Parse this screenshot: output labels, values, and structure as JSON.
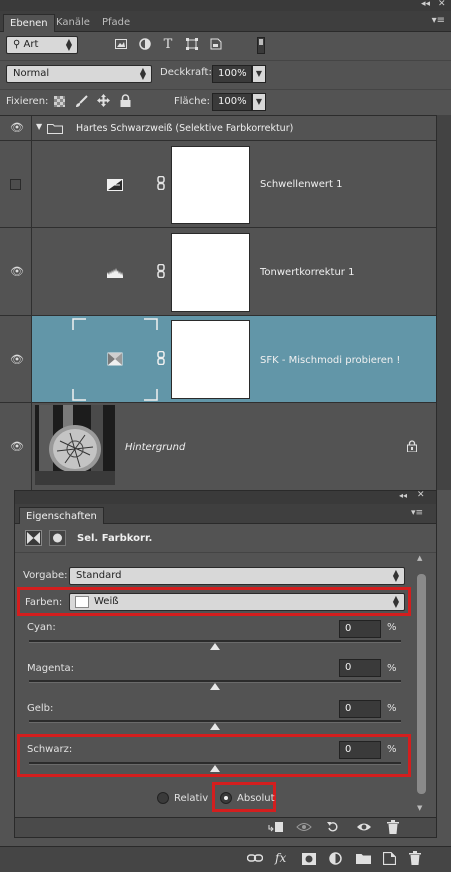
{
  "tabs": [
    {
      "label": "Ebenen",
      "active": true
    },
    {
      "label": "Kanäle",
      "active": false
    },
    {
      "label": "Pfade",
      "active": false
    }
  ],
  "window_controls": {
    "collapse": "◂◂",
    "close": "✕",
    "menu": "▾≡"
  },
  "filter": {
    "kind_value": "Art",
    "icons": [
      "image-filter-icon",
      "adjustment-filter-icon",
      "type-filter-icon",
      "shape-filter-icon",
      "smartobject-filter-icon",
      "filter-toggle-icon"
    ]
  },
  "blend": {
    "mode": "Normal",
    "opacity_label": "Deckkraft:",
    "opacity_value": "100%"
  },
  "lock": {
    "label": "Fixieren:",
    "fill_label": "Fläche:",
    "fill_value": "100%"
  },
  "layers": [
    {
      "name": "Hartes Schwarzweiß (Selektive Farbkorrektur)",
      "type": "group",
      "visible": true
    },
    {
      "name": "Schwellenwert 1",
      "type": "threshold",
      "visible": false
    },
    {
      "name": "Tonwertkorrektur 1",
      "type": "levels",
      "visible": true
    },
    {
      "name": "SFK - Mischmodi probieren !",
      "type": "selective-color",
      "visible": true,
      "selected": true
    },
    {
      "name": "Hintergrund",
      "type": "background",
      "visible": true,
      "locked": true
    }
  ],
  "properties": {
    "tab": "Eigenschaften",
    "title": "Sel. Farbkorr.",
    "preset_label": "Vorgabe:",
    "preset_value": "Standard",
    "colors_label": "Farben:",
    "colors_value": "Weiß",
    "colors_swatch": "#ffffff",
    "sliders": [
      {
        "label": "Cyan:",
        "value": "0",
        "unit": "%",
        "position": 0.5
      },
      {
        "label": "Magenta:",
        "value": "0",
        "unit": "%",
        "position": 0.5
      },
      {
        "label": "Gelb:",
        "value": "0",
        "unit": "%",
        "position": 0.5
      },
      {
        "label": "Schwarz:",
        "value": "0",
        "unit": "%",
        "position": 0.5
      }
    ],
    "radio_relative": "Relativ",
    "radio_absolute": "Absolut",
    "method_selected": "Absolut"
  },
  "colors": {
    "selected_layer": "#6296a8",
    "highlight": "#d41e1e",
    "panel": "#535353"
  }
}
